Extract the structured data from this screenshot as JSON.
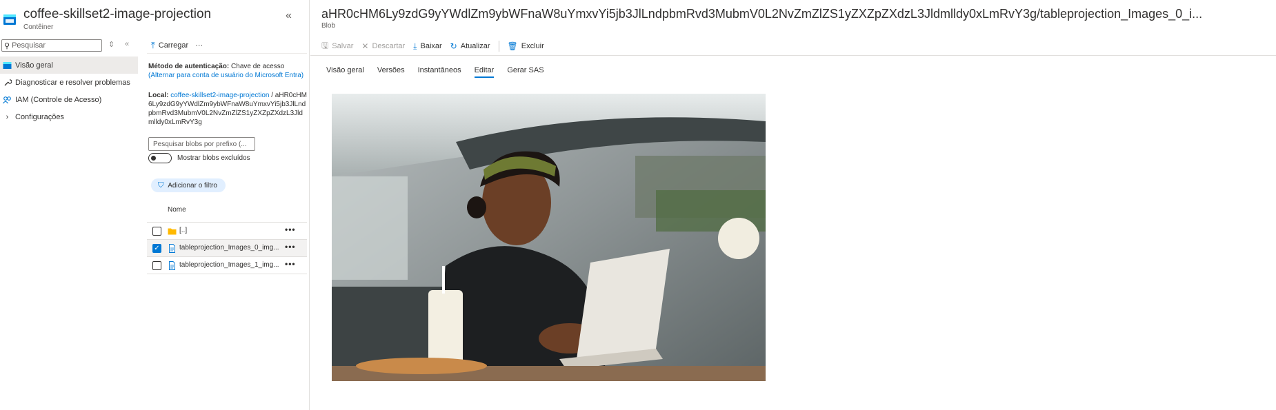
{
  "left": {
    "title": "coffee-skillset2-image-projection",
    "subtitle": "Contêiner",
    "search_placeholder": "Pesquisar",
    "nav": [
      {
        "label": "Visão geral",
        "icon": "container-overview-icon"
      },
      {
        "label": "Diagnosticar e resolver problemas",
        "icon": "wrench-icon"
      },
      {
        "label": "IAM (Controle de Acesso)",
        "icon": "people-icon"
      },
      {
        "label": "Configurações",
        "icon": "chevron-right-icon"
      }
    ]
  },
  "middle": {
    "upload_label": "Carregar",
    "more_label": "···",
    "auth_label": "Método de autenticação:",
    "auth_value": "Chave de acesso",
    "auth_link": "(Alternar para conta de usuário do Microsoft Entra)",
    "location_label": "Local:",
    "location_link": "coffee-skillset2-image-projection",
    "location_sep": "/",
    "location_path": "aHR0cHM6Ly9zdG9yYWdlZm9ybWFnaW8uYmxvYi5jb3JlLndpbmRvd3MubmV0L2NvZmZlZS1yZXZpZXdzL3Jldmlldy0xLmRvY3g",
    "prefix_placeholder": "Pesquisar blobs por prefixo (...",
    "show_deleted_label": "Mostrar blobs excluídos",
    "filter_label": "Adicionar o filtro",
    "column_name": "Nome",
    "rows": [
      {
        "label": "[..]",
        "type": "folder",
        "checked": false
      },
      {
        "label": "tableprojection_Images_0_img...",
        "type": "file",
        "checked": true
      },
      {
        "label": "tableprojection_Images_1_img...",
        "type": "file",
        "checked": false
      }
    ],
    "more_dots": "•••"
  },
  "right": {
    "title": "aHR0cHM6Ly9zdG9yYWdlZm9ybWFnaW8uYmxvYi5jb3JlLndpbmRvd3MubmV0L2NvZmZlZS1yZXZpZXdzL3Jldmlldy0xLmRvY3g/tableprojection_Images_0_i...",
    "subtitle": "Blob",
    "toolbar": {
      "save": "Salvar",
      "discard": "Descartar",
      "download": "Baixar",
      "refresh": "Atualizar",
      "delete": "Excluir"
    },
    "tabs": [
      "Visão geral",
      "Versões",
      "Instantâneos",
      "Editar",
      "Gerar SAS"
    ],
    "active_tab": "Editar"
  },
  "colors": {
    "accent": "#0078d4",
    "folder": "#ffb900",
    "border": "#e1dfdd"
  }
}
